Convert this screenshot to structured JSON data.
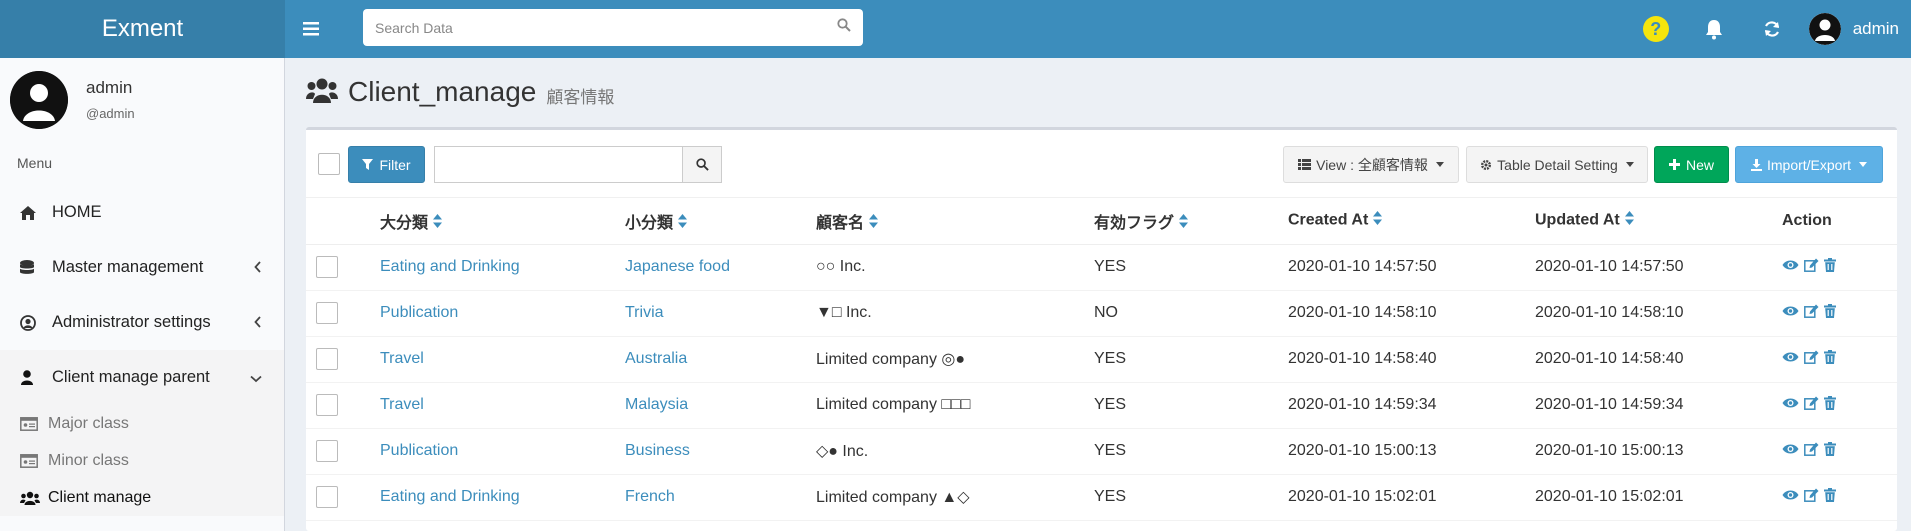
{
  "app": {
    "logo": "Exment"
  },
  "header": {
    "search_placeholder": "Search Data",
    "user_name": "admin",
    "colors": {
      "bar": "#3c8dbc",
      "logo_bg": "#367fa9",
      "help": "#f5e50c"
    }
  },
  "sidebar": {
    "user": {
      "name": "admin",
      "handle": "@admin"
    },
    "menu_header": "Menu",
    "items": [
      {
        "label": "HOME",
        "icon": "home-icon"
      },
      {
        "label": "Master management",
        "icon": "database-icon"
      },
      {
        "label": "Administrator settings",
        "icon": "user-circle-icon"
      },
      {
        "label": "Client manage parent",
        "icon": "user-icon"
      }
    ],
    "subitems": [
      {
        "label": "Major class",
        "icon": "id-card-icon"
      },
      {
        "label": "Minor class",
        "icon": "id-card-icon"
      },
      {
        "label": "Client manage",
        "icon": "users-icon"
      }
    ]
  },
  "page": {
    "title": "Client_manage",
    "subtitle": "顧客情報"
  },
  "toolbar": {
    "filter_label": "Filter",
    "view_label": "View : 全顧客情報",
    "table_setting_label": "Table Detail Setting",
    "new_label": "New",
    "import_export_label": "Import/Export"
  },
  "table": {
    "columns": [
      "大分類",
      "小分類",
      "顧客名",
      "有効フラグ",
      "Created At",
      "Updated At",
      "Action"
    ],
    "rows": [
      {
        "major": "Eating and Drinking",
        "minor": "Japanese food",
        "name": "○○ Inc.",
        "flag": "YES",
        "created": "2020-01-10 14:57:50",
        "updated": "2020-01-10 14:57:50"
      },
      {
        "major": "Publication",
        "minor": "Trivia",
        "name": "▼□ Inc.",
        "flag": "NO",
        "created": "2020-01-10 14:58:10",
        "updated": "2020-01-10 14:58:10"
      },
      {
        "major": "Travel",
        "minor": "Australia",
        "name": "Limited company ◎●",
        "flag": "YES",
        "created": "2020-01-10 14:58:40",
        "updated": "2020-01-10 14:58:40"
      },
      {
        "major": "Travel",
        "minor": "Malaysia",
        "name": "Limited company □□□",
        "flag": "YES",
        "created": "2020-01-10 14:59:34",
        "updated": "2020-01-10 14:59:34"
      },
      {
        "major": "Publication",
        "minor": "Business",
        "name": "◇● Inc.",
        "flag": "YES",
        "created": "2020-01-10 15:00:13",
        "updated": "2020-01-10 15:00:13"
      },
      {
        "major": "Eating and Drinking",
        "minor": "French",
        "name": "Limited company ▲◇",
        "flag": "YES",
        "created": "2020-01-10 15:02:01",
        "updated": "2020-01-10 15:02:01"
      }
    ]
  }
}
